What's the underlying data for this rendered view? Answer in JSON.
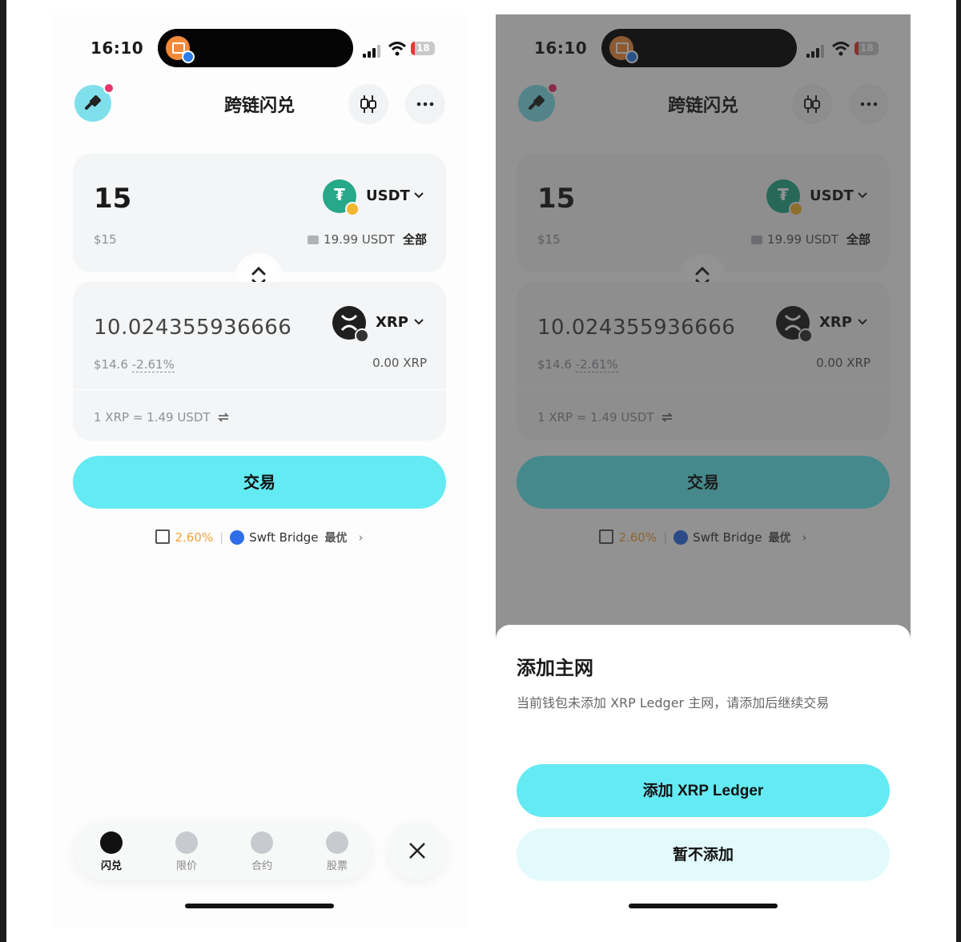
{
  "status": {
    "time": "16:10",
    "battery": "18"
  },
  "header": {
    "title": "跨链闪兑"
  },
  "pay": {
    "amount": "15",
    "usd": "$15",
    "token": "USDT",
    "balance": "19.99 USDT",
    "all_label": "全部"
  },
  "receive": {
    "amount": "10.024355936666",
    "usd": "$14.6",
    "change": "-2.61%",
    "token": "XRP",
    "balance": "0.00 XRP"
  },
  "rate": "1 XRP = 1.49 USDT",
  "trade_button": "交易",
  "route": {
    "fee": "2.60%",
    "provider": "Swft Bridge",
    "best_label": "最优"
  },
  "nav": [
    {
      "label": "闪兑",
      "icon": "swap-icon"
    },
    {
      "label": "限价",
      "icon": "limit-icon"
    },
    {
      "label": "合约",
      "icon": "contract-icon"
    },
    {
      "label": "股票",
      "icon": "stock-icon"
    }
  ],
  "sheet": {
    "title": "添加主网",
    "message": "当前钱包未添加 XRP Ledger 主网，请添加后继续交易",
    "add_button": "添加 XRP Ledger",
    "skip_button": "暂不添加"
  },
  "colors": {
    "accent": "#64eaf3",
    "fee": "#f0a23a",
    "usdt": "#26a889"
  }
}
